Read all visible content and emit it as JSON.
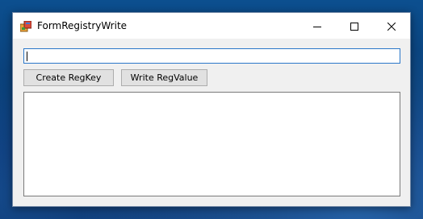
{
  "window": {
    "title": "FormRegistryWrite"
  },
  "caption_buttons": {
    "minimize_icon": "minimize-icon",
    "maximize_icon": "maximize-icon",
    "close_icon": "close-icon"
  },
  "input": {
    "value": "",
    "placeholder": ""
  },
  "buttons": {
    "create_regkey": "Create RegKey",
    "write_regvalue": "Write RegValue"
  },
  "output": {
    "text": ""
  },
  "colors": {
    "input_focus_border": "#2a77c9",
    "button_face": "#e1e1e1",
    "window_face": "#f0f0f0"
  }
}
